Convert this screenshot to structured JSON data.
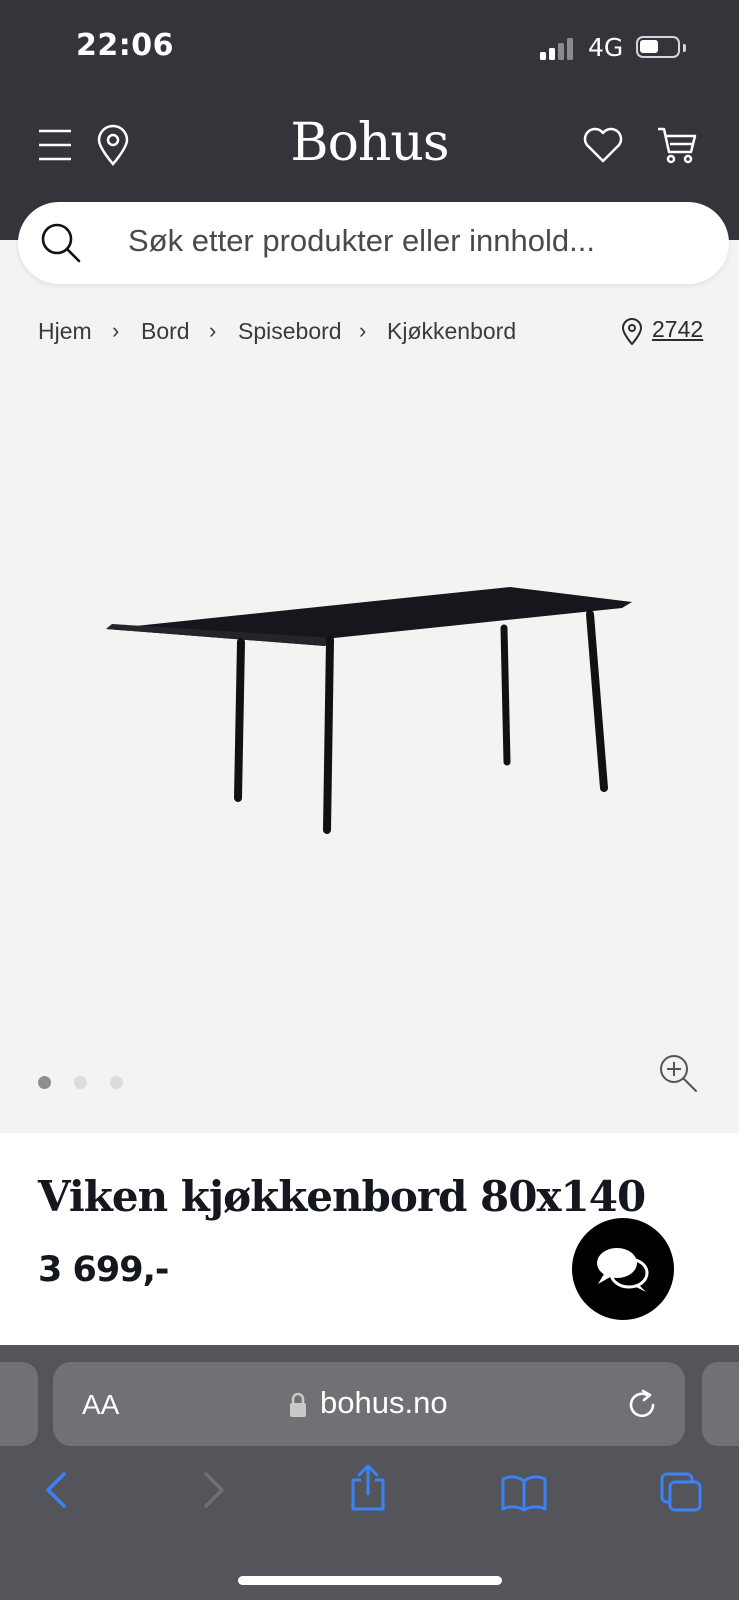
{
  "status_bar": {
    "time": "22:06",
    "network": "4G"
  },
  "header": {
    "logo": "Bohus"
  },
  "search": {
    "placeholder": "Søk etter produkter eller innhold..."
  },
  "breadcrumb": {
    "items": [
      "Hjem",
      "Bord",
      "Spisebord",
      "Kjøkkenbord"
    ],
    "separator": "›",
    "store_number": "2742"
  },
  "gallery": {
    "dot_count": 3,
    "active_dot": 0
  },
  "product": {
    "title": "Viken kjøkkenbord 80x140",
    "price": "3 699,-"
  },
  "browser": {
    "text_size_label": "AA",
    "url": "bohus.no"
  },
  "colors": {
    "header_bg": "#34353a",
    "page_bg": "#f4f3f2",
    "safari_bg": "#54555a",
    "link_blue": "#3b82f6"
  },
  "icons": [
    "menu-icon",
    "location-pin-icon",
    "heart-icon",
    "cart-icon",
    "search-icon",
    "zoom-in-icon",
    "chat-icon",
    "lock-icon",
    "reload-icon",
    "back-icon",
    "forward-icon",
    "share-icon",
    "bookmarks-icon",
    "tabs-icon"
  ]
}
